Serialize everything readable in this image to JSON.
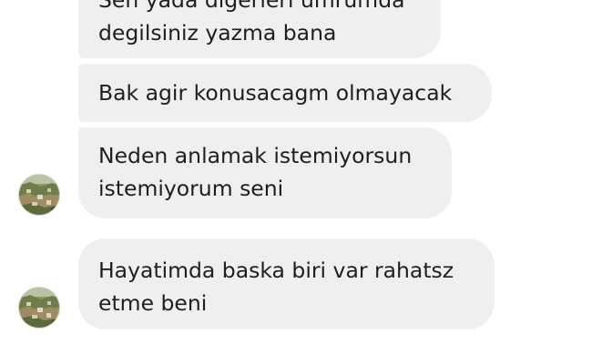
{
  "chat": {
    "messages": [
      {
        "lines": [
          "Sen yada digerleri umrumda",
          "degilsiniz yazma bana"
        ]
      },
      {
        "lines": [
          "Bak agir konusacagm olmayacak"
        ]
      },
      {
        "lines": [
          "Neden anlamak istemiyorsun",
          "istemiyorum seni"
        ]
      },
      {
        "lines": [
          "Hayatimda baska biri var rahatsz",
          "etme beni"
        ]
      }
    ]
  },
  "colors": {
    "bubble_bg": "#efeff0",
    "text": "#1c1e21",
    "background": "#ffffff"
  },
  "icons": {
    "avatar": "contact-avatar-landscape-photo"
  }
}
